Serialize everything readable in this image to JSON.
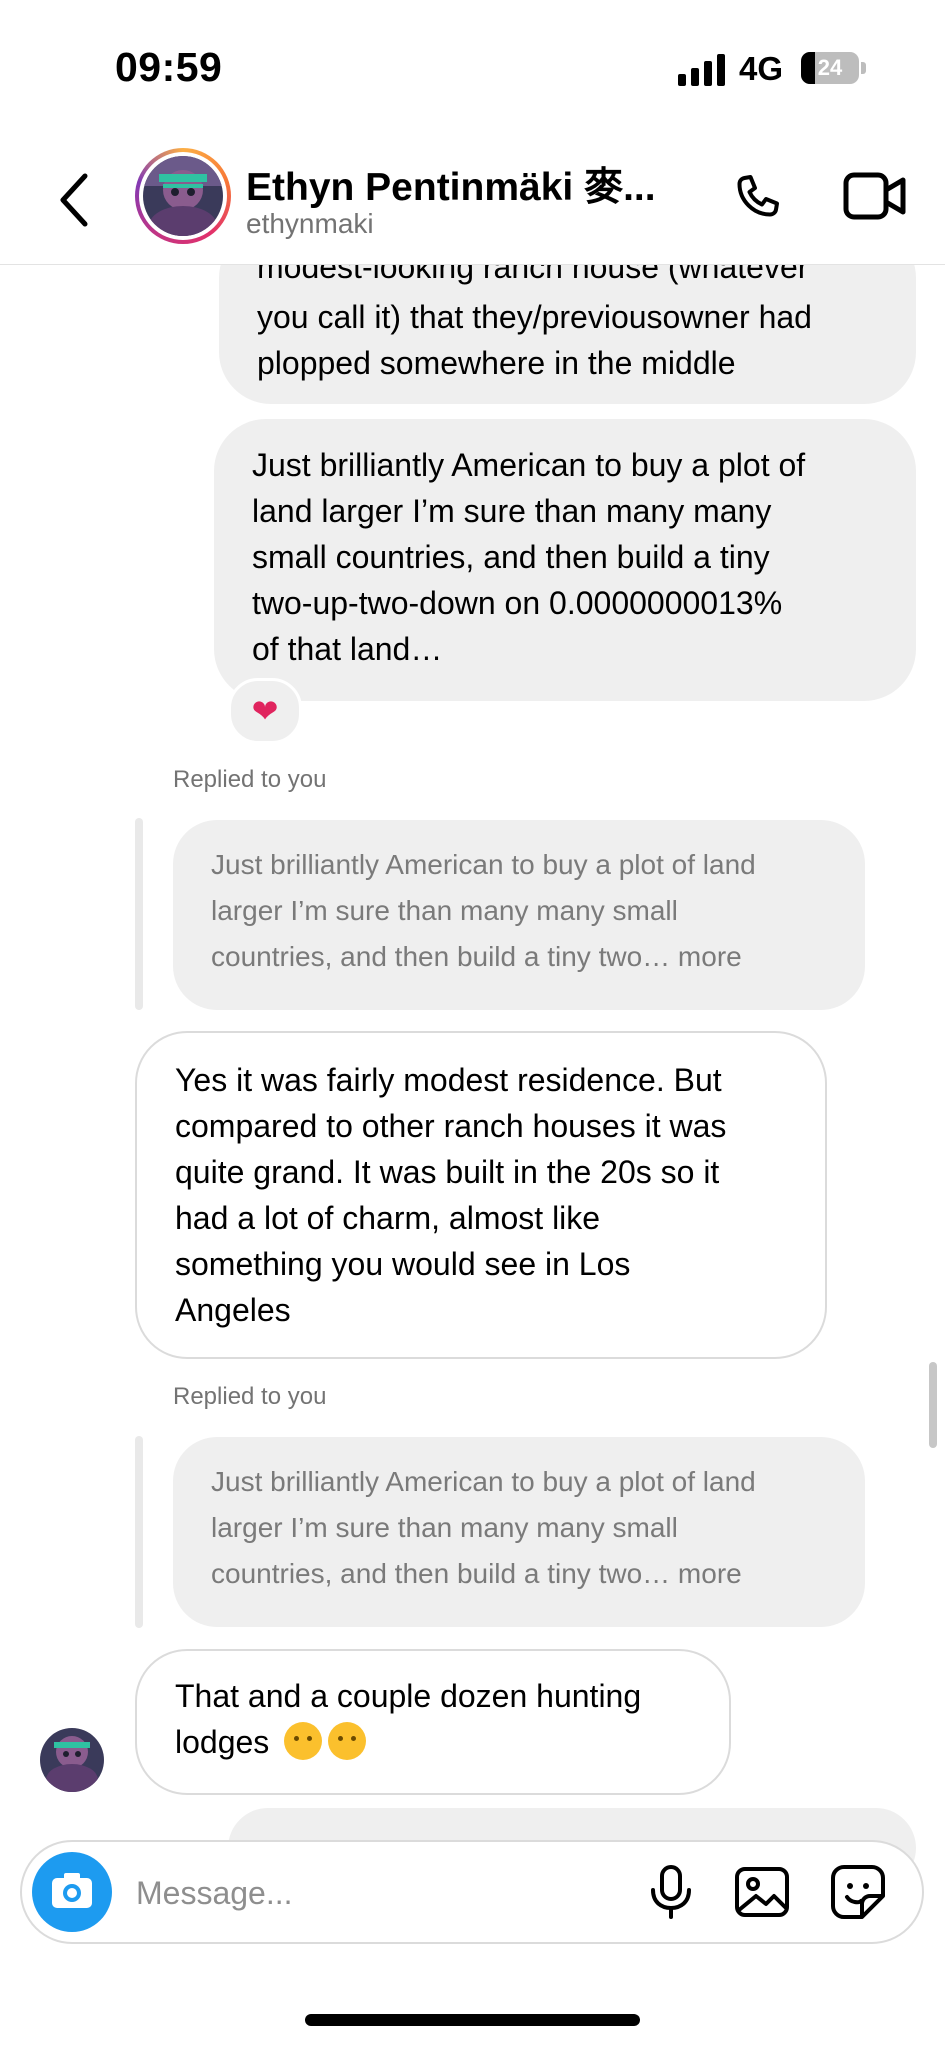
{
  "status_bar": {
    "time": "09:59",
    "network": "4G",
    "battery": "24"
  },
  "header": {
    "name": "Ethyn Pentinmäki 麥...",
    "handle": "ethynmaki"
  },
  "messages": {
    "sent_1": [
      "modest-looking ranch house (whatever",
      "you call it) that they/previousowner had",
      "plopped somewhere in the middle"
    ],
    "sent_2": [
      "Just brilliantly American to buy a plot of",
      "land larger I’m sure than many many",
      "small countries, and then build a tiny",
      "two-up-two-down on 0.0000000013%",
      "of that land…"
    ],
    "reaction": "❤",
    "replied_label": "Replied to you",
    "quote_lines": [
      "Just brilliantly American to buy a plot of land",
      "larger I’m sure than many many small",
      "countries, and then build a tiny two… more"
    ],
    "recv_1": [
      "Yes it was fairly modest residence. But",
      "compared to other ranch houses it was",
      "quite grand. It was built in the 20s so it",
      "had a lot of charm, almost like",
      "something you would see in Los",
      "Angeles"
    ],
    "recv_2": [
      "That and a couple dozen hunting",
      "lodges"
    ]
  },
  "composer": {
    "placeholder": "Message..."
  }
}
